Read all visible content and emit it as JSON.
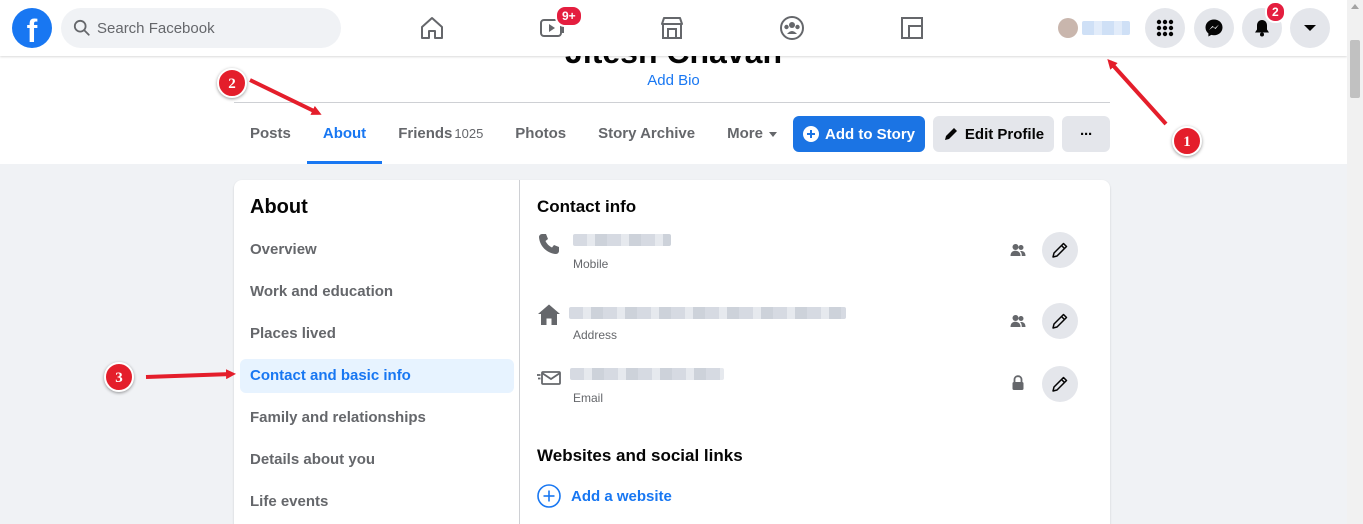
{
  "topbar": {
    "logo_letter": "f",
    "search_placeholder": "Search Facebook",
    "watch_badge": "9+",
    "notifications_badge": "2"
  },
  "profile": {
    "name": "Jitesh Chavan",
    "add_bio": "Add Bio"
  },
  "tabs": [
    {
      "label": "Posts"
    },
    {
      "label": "About"
    },
    {
      "label": "Friends",
      "count": "1025"
    },
    {
      "label": "Photos"
    },
    {
      "label": "Story Archive"
    },
    {
      "label": "More"
    }
  ],
  "header_buttons": {
    "add_to_story": "Add to Story",
    "edit_profile": "Edit Profile",
    "more": "···"
  },
  "about": {
    "title": "About",
    "menu": [
      "Overview",
      "Work and education",
      "Places lived",
      "Contact and basic info",
      "Family and relationships",
      "Details about you",
      "Life events"
    ],
    "contact_info_title": "Contact info",
    "contact_rows": [
      {
        "label": "Mobile",
        "icon": "phone-icon",
        "privacy": "friends-icon"
      },
      {
        "label": "Address",
        "icon": "home-icon",
        "privacy": "friends-icon"
      },
      {
        "label": "Email",
        "icon": "email-icon",
        "privacy": "lock-icon"
      }
    ],
    "websites_title": "Websites and social links",
    "add_website": "Add a website"
  },
  "annotations": [
    "1",
    "2",
    "3"
  ],
  "colors": {
    "brand_blue": "#1877f2",
    "annotation_red": "#e41e2b",
    "page_bg": "#f0f2f5"
  }
}
